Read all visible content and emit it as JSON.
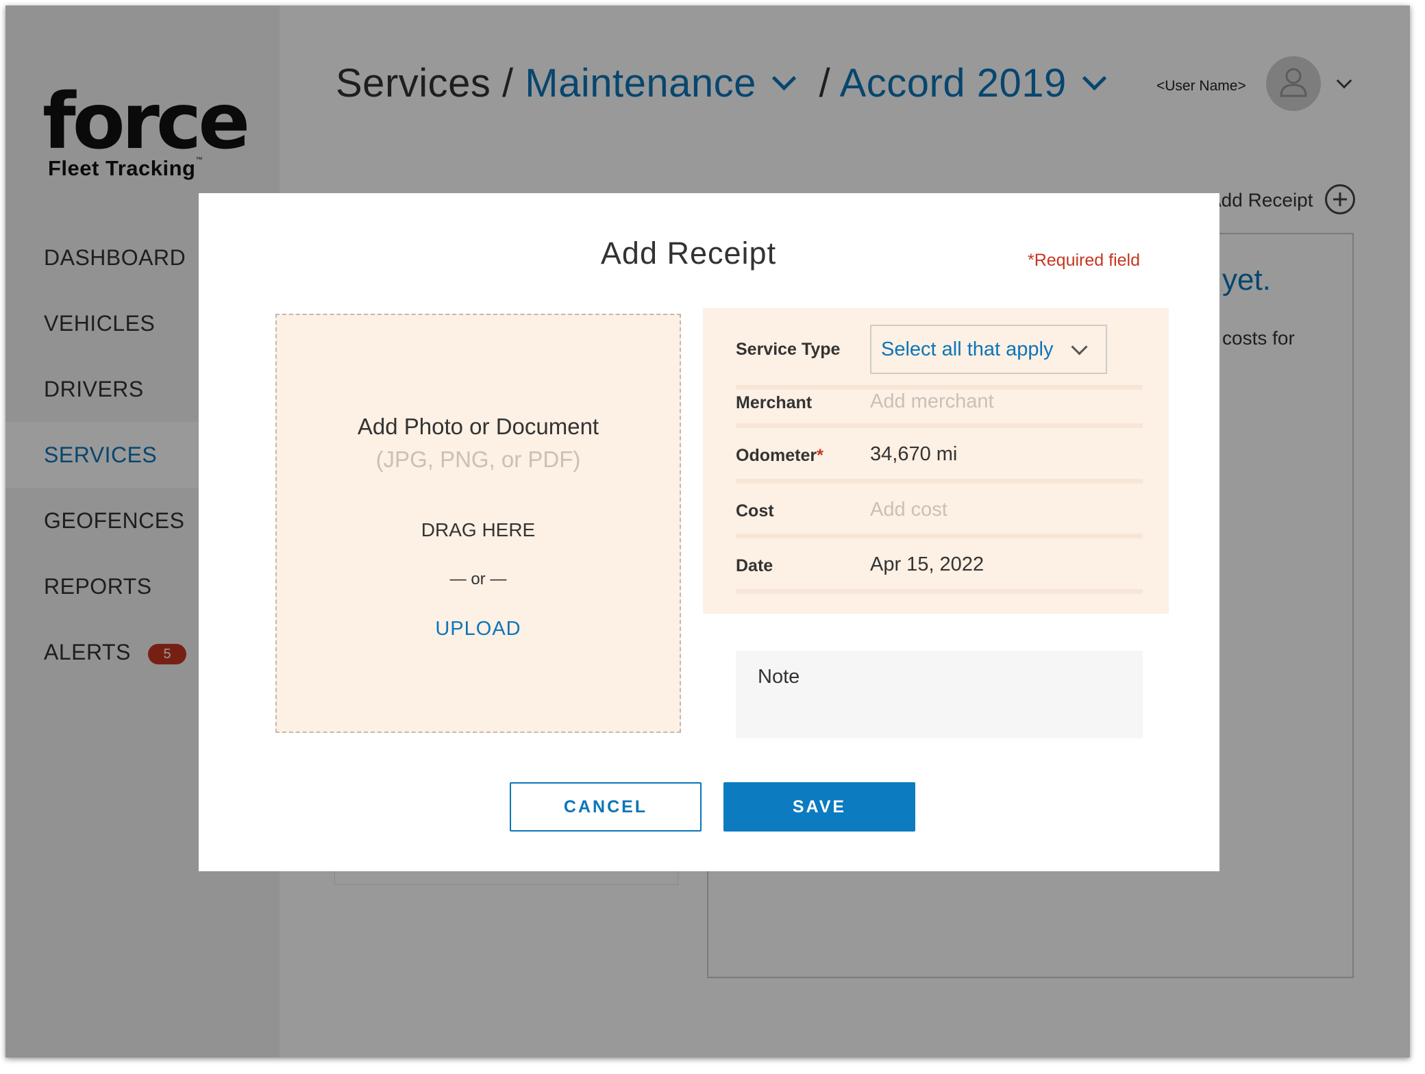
{
  "brand": {
    "logo_word": "force",
    "logo_sub": "Fleet Tracking",
    "logo_tm": "™"
  },
  "sidebar": {
    "items": [
      {
        "label": "DASHBOARD"
      },
      {
        "label": "VEHICLES"
      },
      {
        "label": "DRIVERS"
      },
      {
        "label": "SERVICES",
        "active": true
      },
      {
        "label": "GEOFENCES"
      },
      {
        "label": "REPORTS"
      },
      {
        "label": "ALERTS",
        "badge": "5"
      }
    ]
  },
  "header": {
    "breadcrumb": {
      "root": "Services",
      "separator": "/",
      "level1": "Maintenance",
      "level2": "Accord 2019"
    },
    "user_name": "<User Name>"
  },
  "background_page": {
    "add_receipt_label": "Add Receipt",
    "empty_heading_fragment": "yet.",
    "empty_body_fragment": "costs for"
  },
  "modal": {
    "title": "Add Receipt",
    "required_note": "*Required field",
    "upload": {
      "title": "Add Photo or Document",
      "subtitle": "(JPG, PNG, or PDF)",
      "drag_label": "DRAG HERE",
      "or_label": "— or —",
      "upload_label": "UPLOAD"
    },
    "fields": {
      "service_type": {
        "label": "Service Type",
        "placeholder": "Select all that apply"
      },
      "merchant": {
        "label": "Merchant",
        "placeholder": "Add merchant"
      },
      "odometer": {
        "label": "Odometer",
        "required_mark": "*",
        "value": "34,670 mi"
      },
      "cost": {
        "label": "Cost",
        "placeholder": "Add cost"
      },
      "date": {
        "label": "Date",
        "value": "Apr 15, 2022"
      }
    },
    "note_placeholder": "Note",
    "buttons": {
      "cancel": "CANCEL",
      "save": "SAVE"
    }
  },
  "colors": {
    "accent": "#0c75b8",
    "primary_button": "#0c7bc0",
    "required_red": "#c53620",
    "form_background": "#fdf0e4",
    "overlay": "rgba(0,0,0,0.4)"
  },
  "icons": {
    "avatar": "user-icon",
    "breadcrumb_dropdown": "chevron-down-icon",
    "add": "plus-circle-icon"
  }
}
